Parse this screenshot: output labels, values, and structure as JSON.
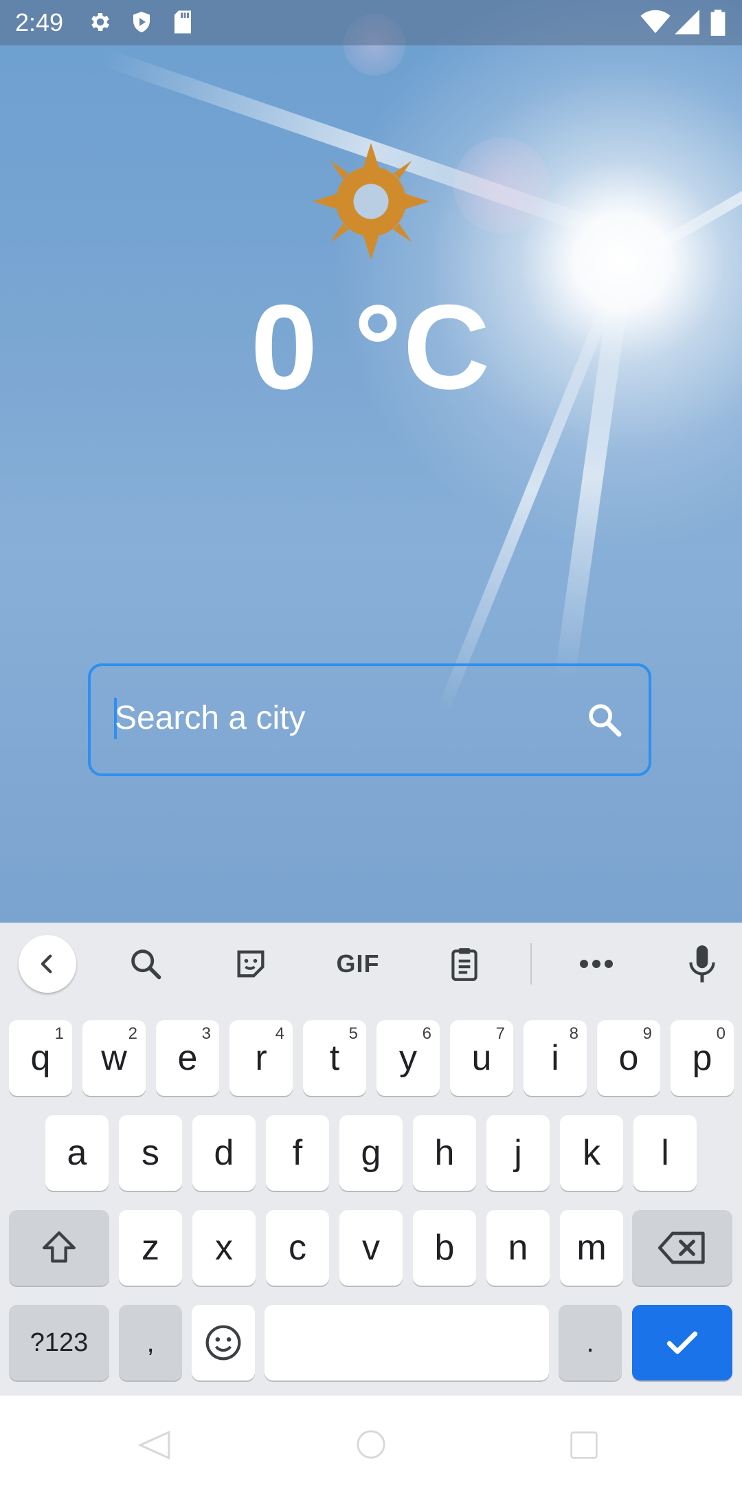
{
  "status_bar": {
    "time": "2:49",
    "left_icons": [
      "settings-icon",
      "shield-icon",
      "sd-card-icon"
    ],
    "right_icons": [
      "wifi-icon",
      "signal-icon",
      "battery-icon"
    ]
  },
  "weather": {
    "icon": "sun-icon",
    "icon_color": "#d08c2c",
    "temperature": "0 °C"
  },
  "search": {
    "placeholder": "Search a city",
    "icon": "search-icon",
    "border_color": "#2f8ff0"
  },
  "keyboard": {
    "toolbar": [
      "back-icon",
      "search-icon",
      "sticker-icon",
      "GIF",
      "clipboard-icon",
      "more-icon",
      "mic-icon"
    ],
    "gif_label": "GIF",
    "row1": [
      {
        "k": "q",
        "n": "1"
      },
      {
        "k": "w",
        "n": "2"
      },
      {
        "k": "e",
        "n": "3"
      },
      {
        "k": "r",
        "n": "4"
      },
      {
        "k": "t",
        "n": "5"
      },
      {
        "k": "y",
        "n": "6"
      },
      {
        "k": "u",
        "n": "7"
      },
      {
        "k": "i",
        "n": "8"
      },
      {
        "k": "o",
        "n": "9"
      },
      {
        "k": "p",
        "n": "0"
      }
    ],
    "row2": [
      "a",
      "s",
      "d",
      "f",
      "g",
      "h",
      "j",
      "k",
      "l"
    ],
    "row3": [
      "z",
      "x",
      "c",
      "v",
      "b",
      "n",
      "m"
    ],
    "symbols_label": "?123",
    "comma_label": ",",
    "period_label": ".",
    "enter_color": "#1a73e8"
  },
  "nav_bar": [
    "back-nav-icon",
    "home-nav-icon",
    "recents-nav-icon"
  ]
}
